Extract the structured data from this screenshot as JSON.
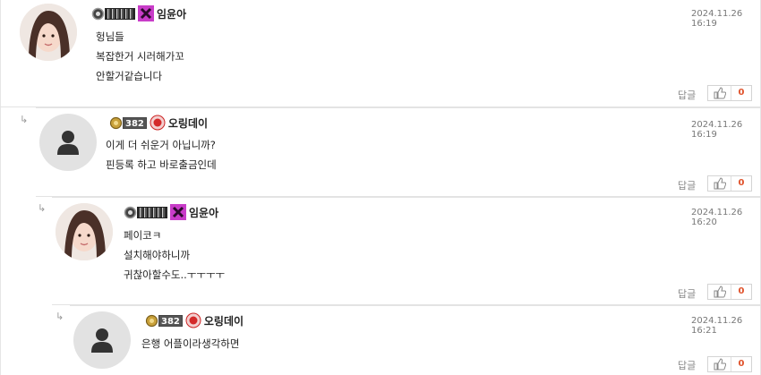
{
  "comments": [
    {
      "nickname": "임윤아",
      "date": "2024.11.26 16:19",
      "lines": [
        "헝님들",
        "복잡한거 시러해가꼬",
        "안할거같습니다"
      ],
      "reply_label": "답글",
      "likes": "0",
      "avatar": "photo-avatar",
      "badge": "level-badge-striped",
      "icon": "x-icon"
    },
    {
      "nickname": "오링데이",
      "date": "2024.11.26 16:19",
      "lines": [
        "이게 더 쉬운거 아닙니까?",
        "핀등록 하고 바로출금인데"
      ],
      "reply_label": "답글",
      "likes": "0",
      "level": "382",
      "avatar": "default-user-avatar",
      "icon": "red-emblem-icon"
    },
    {
      "nickname": "임윤아",
      "date": "2024.11.26 16:20",
      "lines": [
        "페이코ㅋ",
        "설치해야하니까",
        "귀찮아할수도..ㅜㅜㅜㅜ"
      ],
      "reply_label": "답글",
      "likes": "0",
      "avatar": "photo-avatar",
      "badge": "level-badge-striped",
      "icon": "x-icon"
    },
    {
      "nickname": "오링데이",
      "date": "2024.11.26 16:21",
      "lines": [
        "은행 어플이라생각하면"
      ],
      "reply_label": "답글",
      "likes": "0",
      "level": "382",
      "avatar": "default-user-avatar",
      "icon": "red-emblem-icon"
    }
  ],
  "colors": {
    "like_count": "#e0522b",
    "divider": "#e3e3e3",
    "x_icon": "#c83cc8",
    "red_icon": "#d42a2a"
  }
}
